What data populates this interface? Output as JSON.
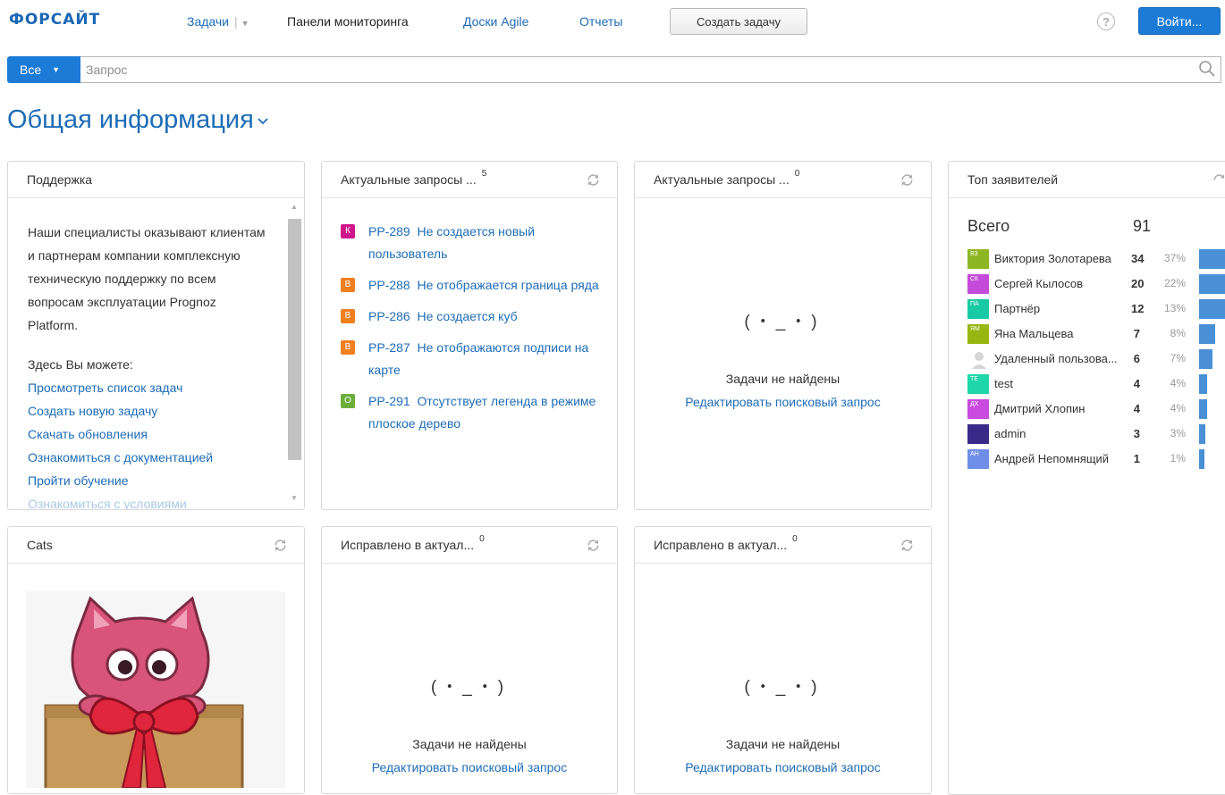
{
  "topbar": {
    "logo": "ФОРСАЙТ",
    "nav": {
      "tasks": "Задачи",
      "dashboards": "Панели мониторинга",
      "agile": "Доски Agile",
      "reports": "Отчеты"
    },
    "create_task": "Создать задачу",
    "help": "?",
    "login": "Войти..."
  },
  "search": {
    "scope": "Все",
    "placeholder": "Запрос"
  },
  "page_title": "Общая информация",
  "gadgets": {
    "support": {
      "title": "Поддержка",
      "intro": "Наши специалисты оказывают клиентам и партнерам компании комплексную техническую поддержку по всем вопросам эксплуатации Prognoz Platform.",
      "you_can": "Здесь Вы можете:",
      "links": [
        "Просмотреть список задач",
        "Создать новую задачу",
        "Скачать обновления",
        "Ознакомиться с документацией",
        "Пройти обучение",
        "Ознакомиться с условиями"
      ]
    },
    "actual1": {
      "title": "Актуальные запросы ...",
      "count": "5",
      "issues": [
        {
          "type": "К",
          "color": "#d0158b",
          "key": "PP-289",
          "summary": "Не создается новый пользователь"
        },
        {
          "type": "В",
          "color": "#f07f1e",
          "key": "PP-288",
          "summary": "Не отображается граница ряда"
        },
        {
          "type": "В",
          "color": "#f07f1e",
          "key": "PP-286",
          "summary": "Не создается куб"
        },
        {
          "type": "В",
          "color": "#f07f1e",
          "key": "PP-287",
          "summary": "Не отображаются подписи на карте"
        },
        {
          "type": "О",
          "color": "#6cae3a",
          "key": "PP-291",
          "summary": "Отсутствует легенда в режиме плоское дерево"
        }
      ]
    },
    "actual2": {
      "title": "Актуальные запросы ...",
      "count": "0",
      "face": "(・_・)",
      "empty": "Задачи не найдены",
      "edit": "Редактировать поисковый запрос"
    },
    "top": {
      "title": "Топ заявителей",
      "total_label": "Всего",
      "total": "91",
      "reporters": [
        {
          "initials": "ВЗ",
          "color": "#8db622",
          "name": "Виктория Золотарева",
          "count": "34",
          "pct": "37%",
          "share": 0.37
        },
        {
          "initials": "СК",
          "color": "#c44bd9",
          "name": "Сергей Кылосов",
          "count": "20",
          "pct": "22%",
          "share": 0.22
        },
        {
          "initials": "ПА",
          "color": "#19c9a6",
          "name": "Партнёр",
          "count": "12",
          "pct": "13%",
          "share": 0.13
        },
        {
          "initials": "ЯМ",
          "color": "#97b612",
          "name": "Яна Мальцева",
          "count": "7",
          "pct": "8%",
          "share": 0.08
        },
        {
          "initials": "",
          "color": "#cccccc",
          "name": "Удаленный пользова...",
          "count": "6",
          "pct": "7%",
          "share": 0.07
        },
        {
          "initials": "TE",
          "color": "#1fd6a8",
          "name": "test",
          "count": "4",
          "pct": "4%",
          "share": 0.04
        },
        {
          "initials": "ДХ",
          "color": "#c94be0",
          "name": "Дмитрий Хлопин",
          "count": "4",
          "pct": "4%",
          "share": 0.04
        },
        {
          "initials": "",
          "color": "#3a2a88",
          "name": "admin",
          "count": "3",
          "pct": "3%",
          "share": 0.03
        },
        {
          "initials": "АН",
          "color": "#6e8ee8",
          "name": "Андрей Непомнящий",
          "count": "1",
          "pct": "1%",
          "share": 0.01
        }
      ]
    },
    "cats": {
      "title": "Cats"
    },
    "fixed1": {
      "title": "Исправлено в актуал...",
      "count": "0",
      "face": "(・_・)",
      "empty": "Задачи не найдены",
      "edit": "Редактировать поисковый запрос"
    },
    "fixed2": {
      "title": "Исправлено в актуал...",
      "count": "0",
      "face": "(・_・)",
      "empty": "Задачи не найдены",
      "edit": "Редактировать поисковый запрос"
    }
  }
}
